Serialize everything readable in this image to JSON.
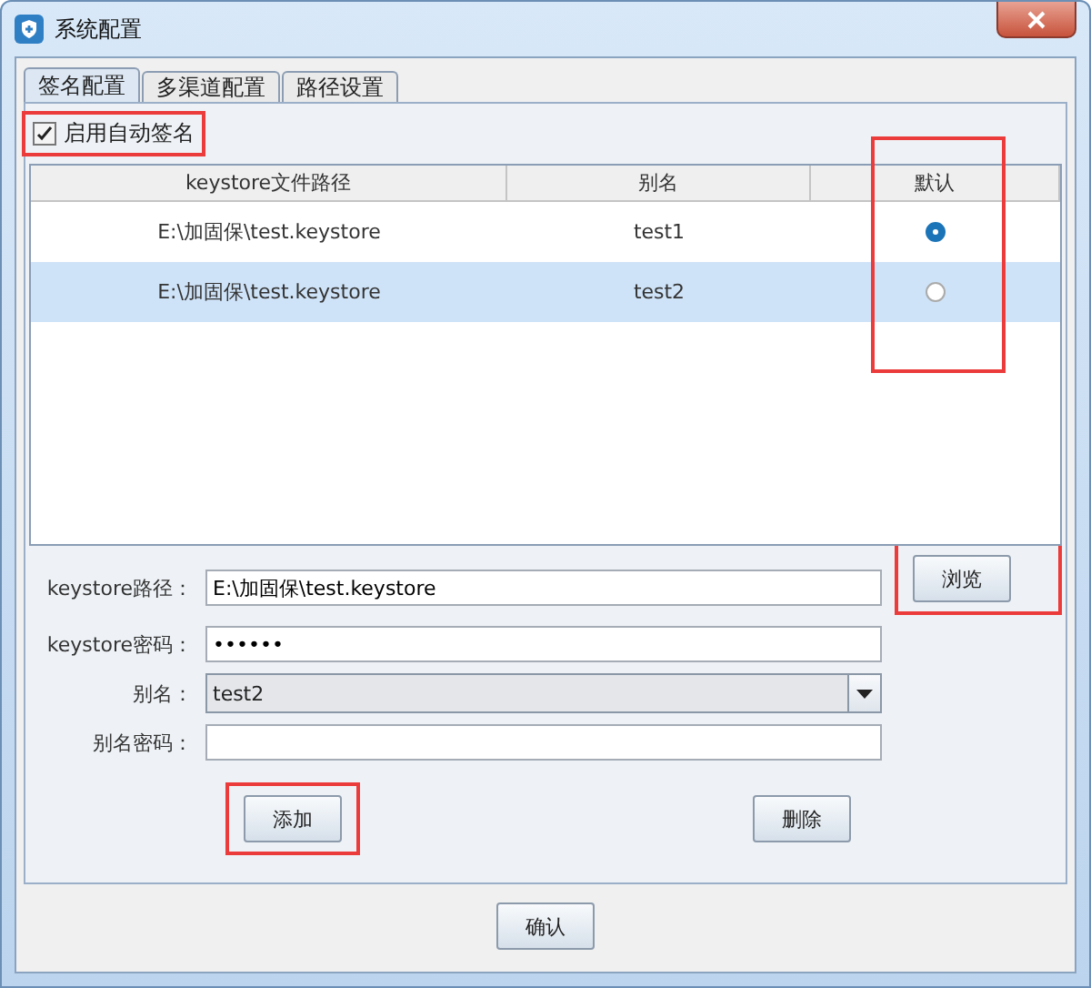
{
  "window": {
    "title": "系统配置"
  },
  "tabs": [
    {
      "label": "签名配置",
      "selected": true
    },
    {
      "label": "多渠道配置",
      "selected": false
    },
    {
      "label": "路径设置",
      "selected": false
    }
  ],
  "auto_sign": {
    "label": "启用自动签名",
    "checked": true
  },
  "table": {
    "columns": [
      "keystore文件路径",
      "别名",
      "默认"
    ],
    "rows": [
      {
        "path": "E:\\加固保\\test.keystore",
        "alias": "test1",
        "default": true,
        "selected": false
      },
      {
        "path": "E:\\加固保\\test.keystore",
        "alias": "test2",
        "default": false,
        "selected": true
      }
    ]
  },
  "form": [
    {
      "kind": "text",
      "label": "keystore路径：",
      "value": "E:\\加固保\\test.keystore"
    },
    {
      "kind": "text",
      "label": "keystore密码：",
      "value": "••••••"
    },
    {
      "kind": "combo",
      "label": "别名：",
      "value": "test2"
    },
    {
      "kind": "text",
      "label": "别名密码："
    }
  ],
  "browse_button": "浏览",
  "add_button": "添加",
  "delete_button": "删除",
  "confirm_button": "确认"
}
